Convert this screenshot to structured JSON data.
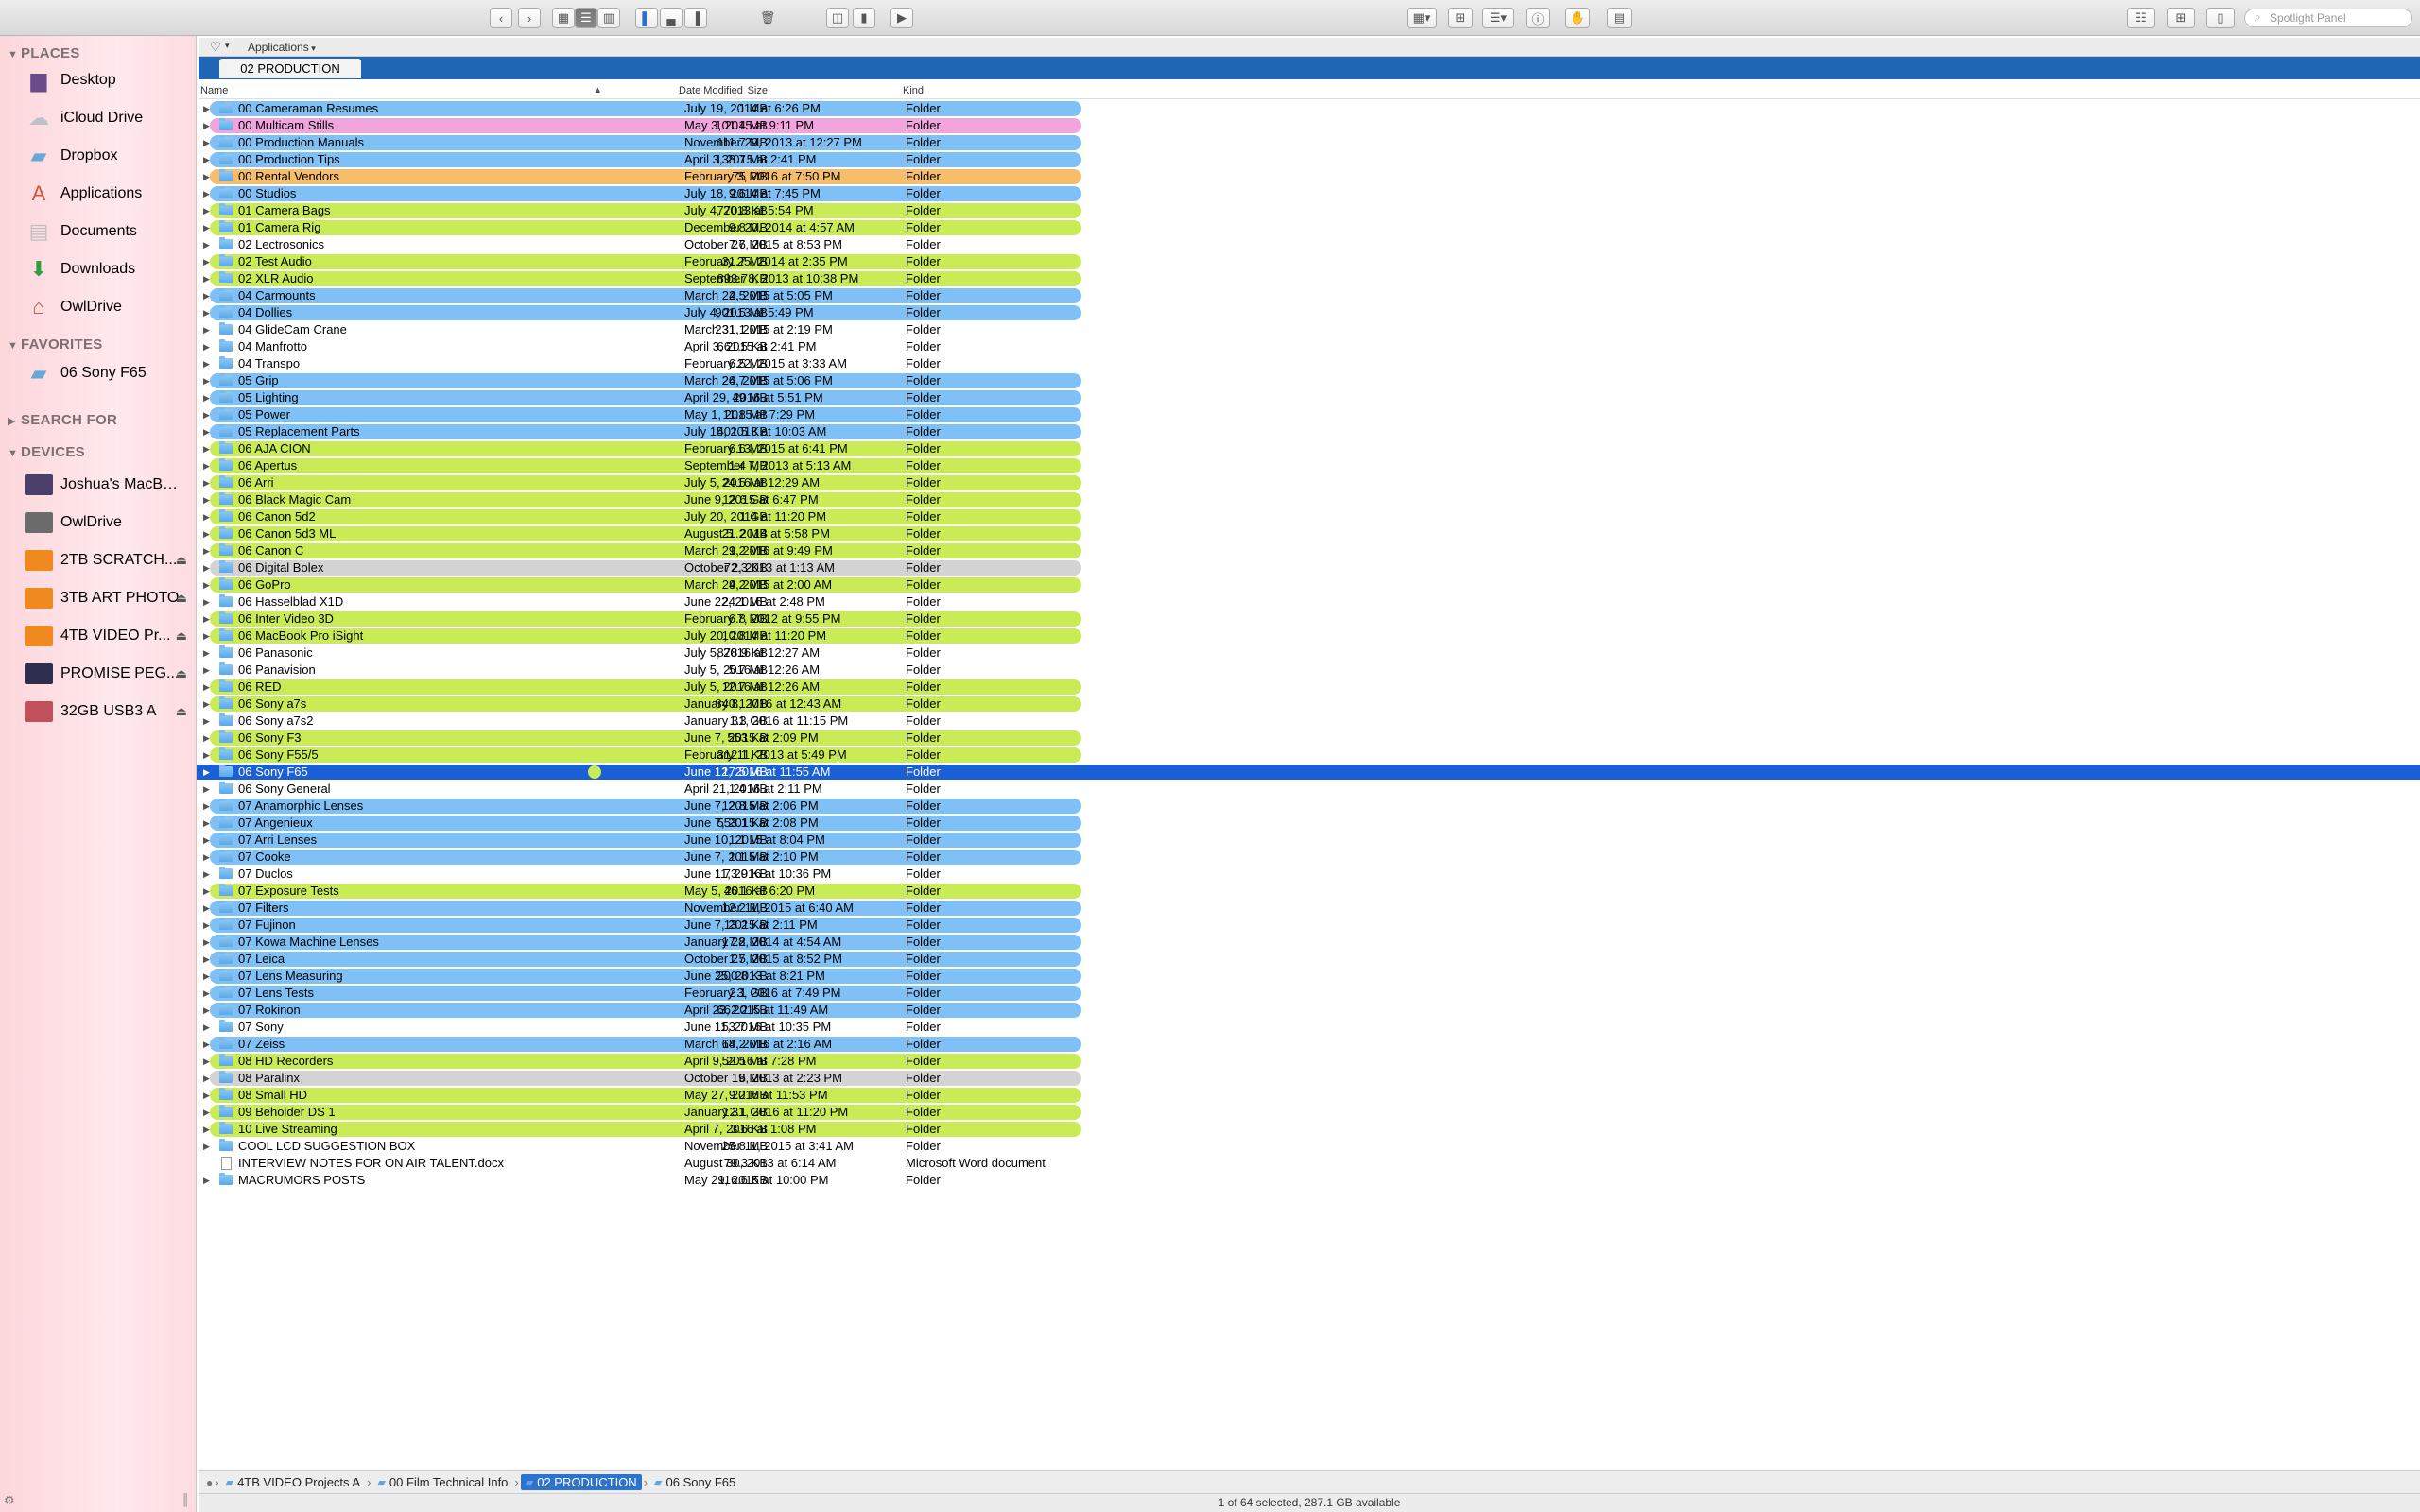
{
  "toolbar": {
    "search_placeholder": "Spotlight Panel",
    "nav_back": "‹",
    "nav_forward": "›"
  },
  "sidebar": {
    "sections": {
      "places": "PLACES",
      "favorites": "FAVORITES",
      "search": "SEARCH FOR",
      "devices": "DEVICES"
    },
    "places": [
      {
        "label": "Desktop",
        "icon": "desktop-icon",
        "glyph": "▆",
        "color": "#6a4c8c"
      },
      {
        "label": "iCloud Drive",
        "icon": "cloud-icon",
        "glyph": "☁",
        "color": "#c0c0c8"
      },
      {
        "label": "Dropbox",
        "icon": "folder-icon",
        "glyph": "▰",
        "color": "#6aa6da"
      },
      {
        "label": "Applications",
        "icon": "applications-icon",
        "glyph": "A",
        "color": "#d6553a"
      },
      {
        "label": "Documents",
        "icon": "documents-icon",
        "glyph": "▤",
        "color": "#bfbfbf"
      },
      {
        "label": "Downloads",
        "icon": "downloads-icon",
        "glyph": "⬇",
        "color": "#2e9e3e"
      },
      {
        "label": "OwlDrive",
        "icon": "home-icon",
        "glyph": "⌂",
        "color": "#b4553a"
      }
    ],
    "favorites": [
      {
        "label": "06 Sony F65",
        "icon": "folder-icon",
        "glyph": "▰",
        "color": "#6aa6da"
      }
    ],
    "devices": [
      {
        "label": "Joshua's MacBo...",
        "icon": "laptop-icon",
        "color": "#4c3e6a",
        "eject": false
      },
      {
        "label": "OwlDrive",
        "icon": "drive-icon",
        "color": "#6c6c6c",
        "eject": false
      },
      {
        "label": "2TB SCRATCH...",
        "icon": "external-drive-icon",
        "color": "#f08a1e",
        "eject": true
      },
      {
        "label": "3TB ART PHOTO",
        "icon": "external-drive-icon",
        "color": "#f08a1e",
        "eject": true
      },
      {
        "label": "4TB VIDEO Pr...",
        "icon": "external-drive-icon",
        "color": "#f08a1e",
        "eject": true
      },
      {
        "label": "PROMISE PEG...",
        "icon": "raid-drive-icon",
        "color": "#2e2e4e",
        "eject": true
      },
      {
        "label": "32GB USB3 A",
        "icon": "usb-drive-icon",
        "color": "#c0505a",
        "eject": true
      }
    ]
  },
  "path_header": {
    "heart": "♡",
    "location": "Applications"
  },
  "tab": {
    "label": "02 PRODUCTION"
  },
  "columns": {
    "name": "Name",
    "size": "Size",
    "date": "Date Modified",
    "kind": "Kind"
  },
  "colors": {
    "blue": "#7fc1f7",
    "green": "#c9ec56",
    "pink": "#f2a4df",
    "orange": "#f8bd6a",
    "gray": "#d3d3d3",
    "none": "transparent",
    "selected": "#1a5fd6"
  },
  "rows": [
    {
      "name": "00 Cameraman Resumes",
      "size": "1 MB",
      "date": "July 19, 2014 at 6:26 PM",
      "kind": "Folder",
      "color": "blue"
    },
    {
      "name": "00 Multicam Stills",
      "size": "101.4 MB",
      "date": "May 3, 2015 at 9:11 PM",
      "kind": "Folder",
      "color": "pink"
    },
    {
      "name": "00 Production Manuals",
      "size": "111.7 MB",
      "date": "November 29, 2013 at 12:27 PM",
      "kind": "Folder",
      "color": "blue"
    },
    {
      "name": "00 Production Tips",
      "size": "138.7 MB",
      "date": "April 3, 2015 at 2:41 PM",
      "kind": "Folder",
      "color": "blue"
    },
    {
      "name": "00 Rental Vendors",
      "size": "75 MB",
      "date": "February 3, 2016 at 7:50 PM",
      "kind": "Folder",
      "color": "orange"
    },
    {
      "name": "00 Studios",
      "size": "9.6 MB",
      "date": "July 18, 2014 at 7:45 PM",
      "kind": "Folder",
      "color": "blue"
    },
    {
      "name": "01 Camera Bags",
      "size": "770.8 KB",
      "date": "July 4, 2013 at 5:54 PM",
      "kind": "Folder",
      "color": "green"
    },
    {
      "name": "01 Camera Rig",
      "size": "9.8 MB",
      "date": "December 20, 2014 at 4:57 AM",
      "kind": "Folder",
      "color": "green"
    },
    {
      "name": "02 Lectrosonics",
      "size": "7.6 MB",
      "date": "October 27, 2015 at 8:53 PM",
      "kind": "Folder",
      "color": "none"
    },
    {
      "name": "02 Test Audio",
      "size": "31.7 MB",
      "date": "February 25, 2014 at 2:35 PM",
      "kind": "Folder",
      "color": "green"
    },
    {
      "name": "02 XLR Audio",
      "size": "893.7 KB",
      "date": "September 8, 2013 at 10:38 PM",
      "kind": "Folder",
      "color": "green"
    },
    {
      "name": "04 Carmounts",
      "size": "2.5 MB",
      "date": "March 24, 2015 at 5:05 PM",
      "kind": "Folder",
      "color": "blue"
    },
    {
      "name": "04 Dollies",
      "size": "901.5 MB",
      "date": "July 4, 2013 at 5:49 PM",
      "kind": "Folder",
      "color": "blue"
    },
    {
      "name": "04 GlideCam Crane",
      "size": "231.1 MB",
      "date": "March 31, 2015 at 2:19 PM",
      "kind": "Folder",
      "color": "none"
    },
    {
      "name": "04 Manfrotto",
      "size": "661.5 KB",
      "date": "April 3, 2015 at 2:41 PM",
      "kind": "Folder",
      "color": "none"
    },
    {
      "name": "04 Transpo",
      "size": "6.5 MB",
      "date": "February 22, 2015 at 3:33 AM",
      "kind": "Folder",
      "color": "none"
    },
    {
      "name": "05 Grip",
      "size": "26.7 MB",
      "date": "March 24, 2015 at 5:06 PM",
      "kind": "Folder",
      "color": "blue"
    },
    {
      "name": "05 Lighting",
      "size": "49 MB",
      "date": "April 29, 2016 at 5:51 PM",
      "kind": "Folder",
      "color": "blue"
    },
    {
      "name": "05 Power",
      "size": "11.8 MB",
      "date": "May 1, 2015 at 7:29 PM",
      "kind": "Folder",
      "color": "blue"
    },
    {
      "name": "05 Replacement Parts",
      "size": "401.5 KB",
      "date": "July 15, 2013 at 10:03 AM",
      "kind": "Folder",
      "color": "blue"
    },
    {
      "name": "06 AJA CION",
      "size": "6.6 MB",
      "date": "February 13, 2015 at 6:41 PM",
      "kind": "Folder",
      "color": "green"
    },
    {
      "name": "06 Apertus",
      "size": "1.4 MB",
      "date": "September 7, 2013 at 5:13 AM",
      "kind": "Folder",
      "color": "green"
    },
    {
      "name": "06 Arri",
      "size": "24.5 MB",
      "date": "July 5, 2016 at 12:29 AM",
      "kind": "Folder",
      "color": "green"
    },
    {
      "name": "06 Black Magic Cam",
      "size": "12.6 GB",
      "date": "June 9, 2015 at 6:47 PM",
      "kind": "Folder",
      "color": "green"
    },
    {
      "name": "06 Canon 5d2",
      "size": "1 GB",
      "date": "July 20, 2014 at 11:20 PM",
      "kind": "Folder",
      "color": "green"
    },
    {
      "name": "06 Canon 5d3 ML",
      "size": "21.2 MB",
      "date": "August 5, 2014 at 5:58 PM",
      "kind": "Folder",
      "color": "green"
    },
    {
      "name": "06 Canon C",
      "size": "9.2 MB",
      "date": "March 21, 2016 at 9:49 PM",
      "kind": "Folder",
      "color": "green"
    },
    {
      "name": "06 Digital Bolex",
      "size": "72.3 KB",
      "date": "October 2, 2013 at 1:13 AM",
      "kind": "Folder",
      "color": "gray"
    },
    {
      "name": "06 GoPro",
      "size": "4.2 MB",
      "date": "March 29, 2015 at 2:00 AM",
      "kind": "Folder",
      "color": "green"
    },
    {
      "name": "06 Hasselblad X1D",
      "size": "24.1 MB",
      "date": "June 22, 2016 at 2:48 PM",
      "kind": "Folder",
      "color": "none"
    },
    {
      "name": "06 Inter Video 3D",
      "size": "6.8 MB",
      "date": "February 7, 2012 at 9:55 PM",
      "kind": "Folder",
      "color": "green"
    },
    {
      "name": "06 MacBook Pro iSight",
      "size": "10.8 MB",
      "date": "July 20, 2014 at 11:20 PM",
      "kind": "Folder",
      "color": "green"
    },
    {
      "name": "06 Panasonic",
      "size": "878.9 KB",
      "date": "July 5, 2016 at 12:27 AM",
      "kind": "Folder",
      "color": "none"
    },
    {
      "name": "06 Panavision",
      "size": "5.7 MB",
      "date": "July 5, 2016 at 12:26 AM",
      "kind": "Folder",
      "color": "none"
    },
    {
      "name": "06 RED",
      "size": "12.7 MB",
      "date": "July 5, 2016 at 12:26 AM",
      "kind": "Folder",
      "color": "green"
    },
    {
      "name": "06 Sony a7s",
      "size": "840.1 MB",
      "date": "January 8, 2016 at 12:43 AM",
      "kind": "Folder",
      "color": "green"
    },
    {
      "name": "06 Sony a7s2",
      "size": "1.3 GB",
      "date": "January 31, 2016 at 11:15 PM",
      "kind": "Folder",
      "color": "none"
    },
    {
      "name": "06 Sony F3",
      "size": "553 KB",
      "date": "June 7, 2015 at 2:09 PM",
      "kind": "Folder",
      "color": "green"
    },
    {
      "name": "06 Sony F55/5",
      "size": "312.1 KB",
      "date": "February 11, 2013 at 5:49 PM",
      "kind": "Folder",
      "color": "green"
    },
    {
      "name": "06 Sony F65",
      "size": "17.5 MB",
      "date": "June 12, 2016 at 11:55 AM",
      "kind": "Folder",
      "color": "green",
      "selected": true
    },
    {
      "name": "06 Sony General",
      "size": "1.4 MB",
      "date": "April 21, 2016 at 2:11 PM",
      "kind": "Folder",
      "color": "none"
    },
    {
      "name": "07 Anamorphic Lenses",
      "size": "12.8 MB",
      "date": "June 7, 2015 at 2:06 PM",
      "kind": "Folder",
      "color": "blue"
    },
    {
      "name": "07 Angenieux",
      "size": "553.1 KB",
      "date": "June 7, 2015 at 2:08 PM",
      "kind": "Folder",
      "color": "blue"
    },
    {
      "name": "07 Arri Lenses",
      "size": "1.1 MB",
      "date": "June 10, 2015 at 8:04 PM",
      "kind": "Folder",
      "color": "blue"
    },
    {
      "name": "07 Cooke",
      "size": "1.1 MB",
      "date": "June 7, 2015 at 2:10 PM",
      "kind": "Folder",
      "color": "blue"
    },
    {
      "name": "07 Duclos",
      "size": "73.9 KB",
      "date": "June 11, 2016 at 10:36 PM",
      "kind": "Folder",
      "color": "none"
    },
    {
      "name": "07 Exposure Tests",
      "size": "46.1 KB",
      "date": "May 5, 2016 at 6:20 PM",
      "kind": "Folder",
      "color": "green"
    },
    {
      "name": "07 Filters",
      "size": "12.2 MB",
      "date": "November 11, 2015 at 6:40 AM",
      "kind": "Folder",
      "color": "blue"
    },
    {
      "name": "07 Fujinon",
      "size": "13.2 KB",
      "date": "June 7, 2015 at 2:11 PM",
      "kind": "Folder",
      "color": "blue"
    },
    {
      "name": "07 Kowa Machine Lenses",
      "size": "17.2 MB",
      "date": "January 28, 2014 at 4:54 AM",
      "kind": "Folder",
      "color": "blue"
    },
    {
      "name": "07 Leica",
      "size": "1.5 MB",
      "date": "October 27, 2015 at 8:52 PM",
      "kind": "Folder",
      "color": "blue"
    },
    {
      "name": "07 Lens Measuring",
      "size": "200.8 KB",
      "date": "June 25, 2013 at 8:21 PM",
      "kind": "Folder",
      "color": "blue"
    },
    {
      "name": "07 Lens Tests",
      "size": "2.1 GB",
      "date": "February 3, 2016 at 7:49 PM",
      "kind": "Folder",
      "color": "blue"
    },
    {
      "name": "07 Rokinon",
      "size": "662.2 KB",
      "date": "April 23, 2015 at 11:49 AM",
      "kind": "Folder",
      "color": "blue"
    },
    {
      "name": "07 Sony",
      "size": "53.7 MB",
      "date": "June 11, 2016 at 10:35 PM",
      "kind": "Folder",
      "color": "none"
    },
    {
      "name": "07 Zeiss",
      "size": "64.2 MB",
      "date": "March 18, 2016 at 2:16 AM",
      "kind": "Folder",
      "color": "blue"
    },
    {
      "name": "08 HD Recorders",
      "size": "52.5 MB",
      "date": "April 9, 2016 at 7:28 PM",
      "kind": "Folder",
      "color": "green"
    },
    {
      "name": "08 Paralinx",
      "size": "6 MB",
      "date": "October 19, 2013 at 2:23 PM",
      "kind": "Folder",
      "color": "gray"
    },
    {
      "name": "08 Small HD",
      "size": "9.2 MB",
      "date": "May 27, 2015 at 11:53 PM",
      "kind": "Folder",
      "color": "green"
    },
    {
      "name": "09 Beholder DS 1",
      "size": "12.1 GB",
      "date": "January 31, 2016 at 11:20 PM",
      "kind": "Folder",
      "color": "green"
    },
    {
      "name": "10 Live Streaming",
      "size": "3.6 KB",
      "date": "April 7, 2016 at 1:08 PM",
      "kind": "Folder",
      "color": "green"
    },
    {
      "name": "COOL LCD SUGGESTION BOX",
      "size": "25.8 MB",
      "date": "November 11, 2015 at 3:41 AM",
      "kind": "Folder",
      "color": "none"
    },
    {
      "name": "INTERVIEW NOTES FOR ON AIR TALENT.docx",
      "size": "79.3 KB",
      "date": "August 30, 2013 at 6:14 AM",
      "kind": "Microsoft Word document",
      "color": "none",
      "file": true
    },
    {
      "name": "MACRUMORS POSTS",
      "size": "116.6 KB",
      "date": "May 29, 2015 at 10:00 PM",
      "kind": "Folder",
      "color": "none"
    }
  ],
  "pathbar": {
    "crumbs": [
      "4TB VIDEO Projects A",
      "00 Film Technical Info",
      "02 PRODUCTION",
      "06 Sony F65"
    ],
    "selected_index": 2
  },
  "status": {
    "text": "1 of 64 selected, 287.1 GB available"
  }
}
